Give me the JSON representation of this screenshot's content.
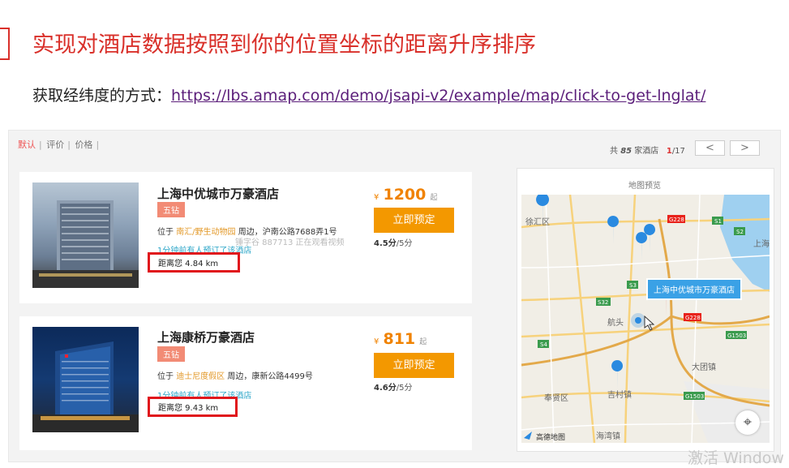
{
  "slide": {
    "title": "实现对酒店数据按照到你的位置坐标的距离升序排序",
    "subtitle_prefix": "获取经纬度的方式：",
    "subtitle_link": "https://lbs.amap.com/demo/jsapi-v2/example/map/click-to-get-lnglat/"
  },
  "sort": {
    "default_label": "默认",
    "rating_label": "评价",
    "price_label": "价格",
    "separator": "|"
  },
  "pager": {
    "total_prefix": "共",
    "total": "85",
    "total_suffix": "家酒店",
    "current": "1",
    "pages": "/17",
    "prev": "<",
    "next": ">"
  },
  "hotels": [
    {
      "name": "上海中优城市万豪酒店",
      "badge": "五钻",
      "addr_prefix": "位于",
      "spot": "南汇/野生动物园",
      "addr_suffix": "周边，沪南公路7688弄1号",
      "booked": "1分钟前有人预订了该酒店",
      "distance": "距离您 4.84 km",
      "currency": "¥",
      "price": "1200",
      "price_suffix": "起",
      "book_label": "立即预定",
      "score": "4.5分",
      "score_suffix": "/5分"
    },
    {
      "name": "上海康桥万豪酒店",
      "badge": "五钻",
      "addr_prefix": "位于",
      "spot": "迪士尼度假区",
      "addr_suffix": "周边，康新公路4499号",
      "booked": "1分钟前有人预订了该酒店",
      "distance": "距离您 9.43 km",
      "currency": "¥",
      "price": "811",
      "price_suffix": "起",
      "book_label": "立即预定",
      "score": "4.6分",
      "score_suffix": "/5分"
    }
  ],
  "watermark": "锤字谷 887713 正在观看视频",
  "map": {
    "title": "地图预览",
    "callout": "上海中优城市万豪酒店",
    "labels": {
      "xuhui": "徐汇区",
      "shanghai": "上海",
      "hangtou": "航头",
      "datuan": "大团镇",
      "fengxian": "奉贤区",
      "jicun": "吉村镇",
      "haiwan": "海湾镇"
    },
    "roads": {
      "g228a": "G228",
      "s1": "S1",
      "s2": "S2",
      "s3": "S3",
      "s32": "S32",
      "g228b": "G228",
      "g1503a": "G1503",
      "s4": "S4",
      "g1503b": "G1503"
    },
    "logo": "高德地图",
    "locate_icon": "⌖"
  },
  "os_overlay": "激活 Window",
  "colors": {
    "title_red": "#d9302a",
    "accent_orange": "#f39800",
    "badge_pink": "#f28b75",
    "distance_box": "#e0161c",
    "map_marker_blue": "#2a8ae0",
    "map_marker_red": "#e8221b"
  }
}
